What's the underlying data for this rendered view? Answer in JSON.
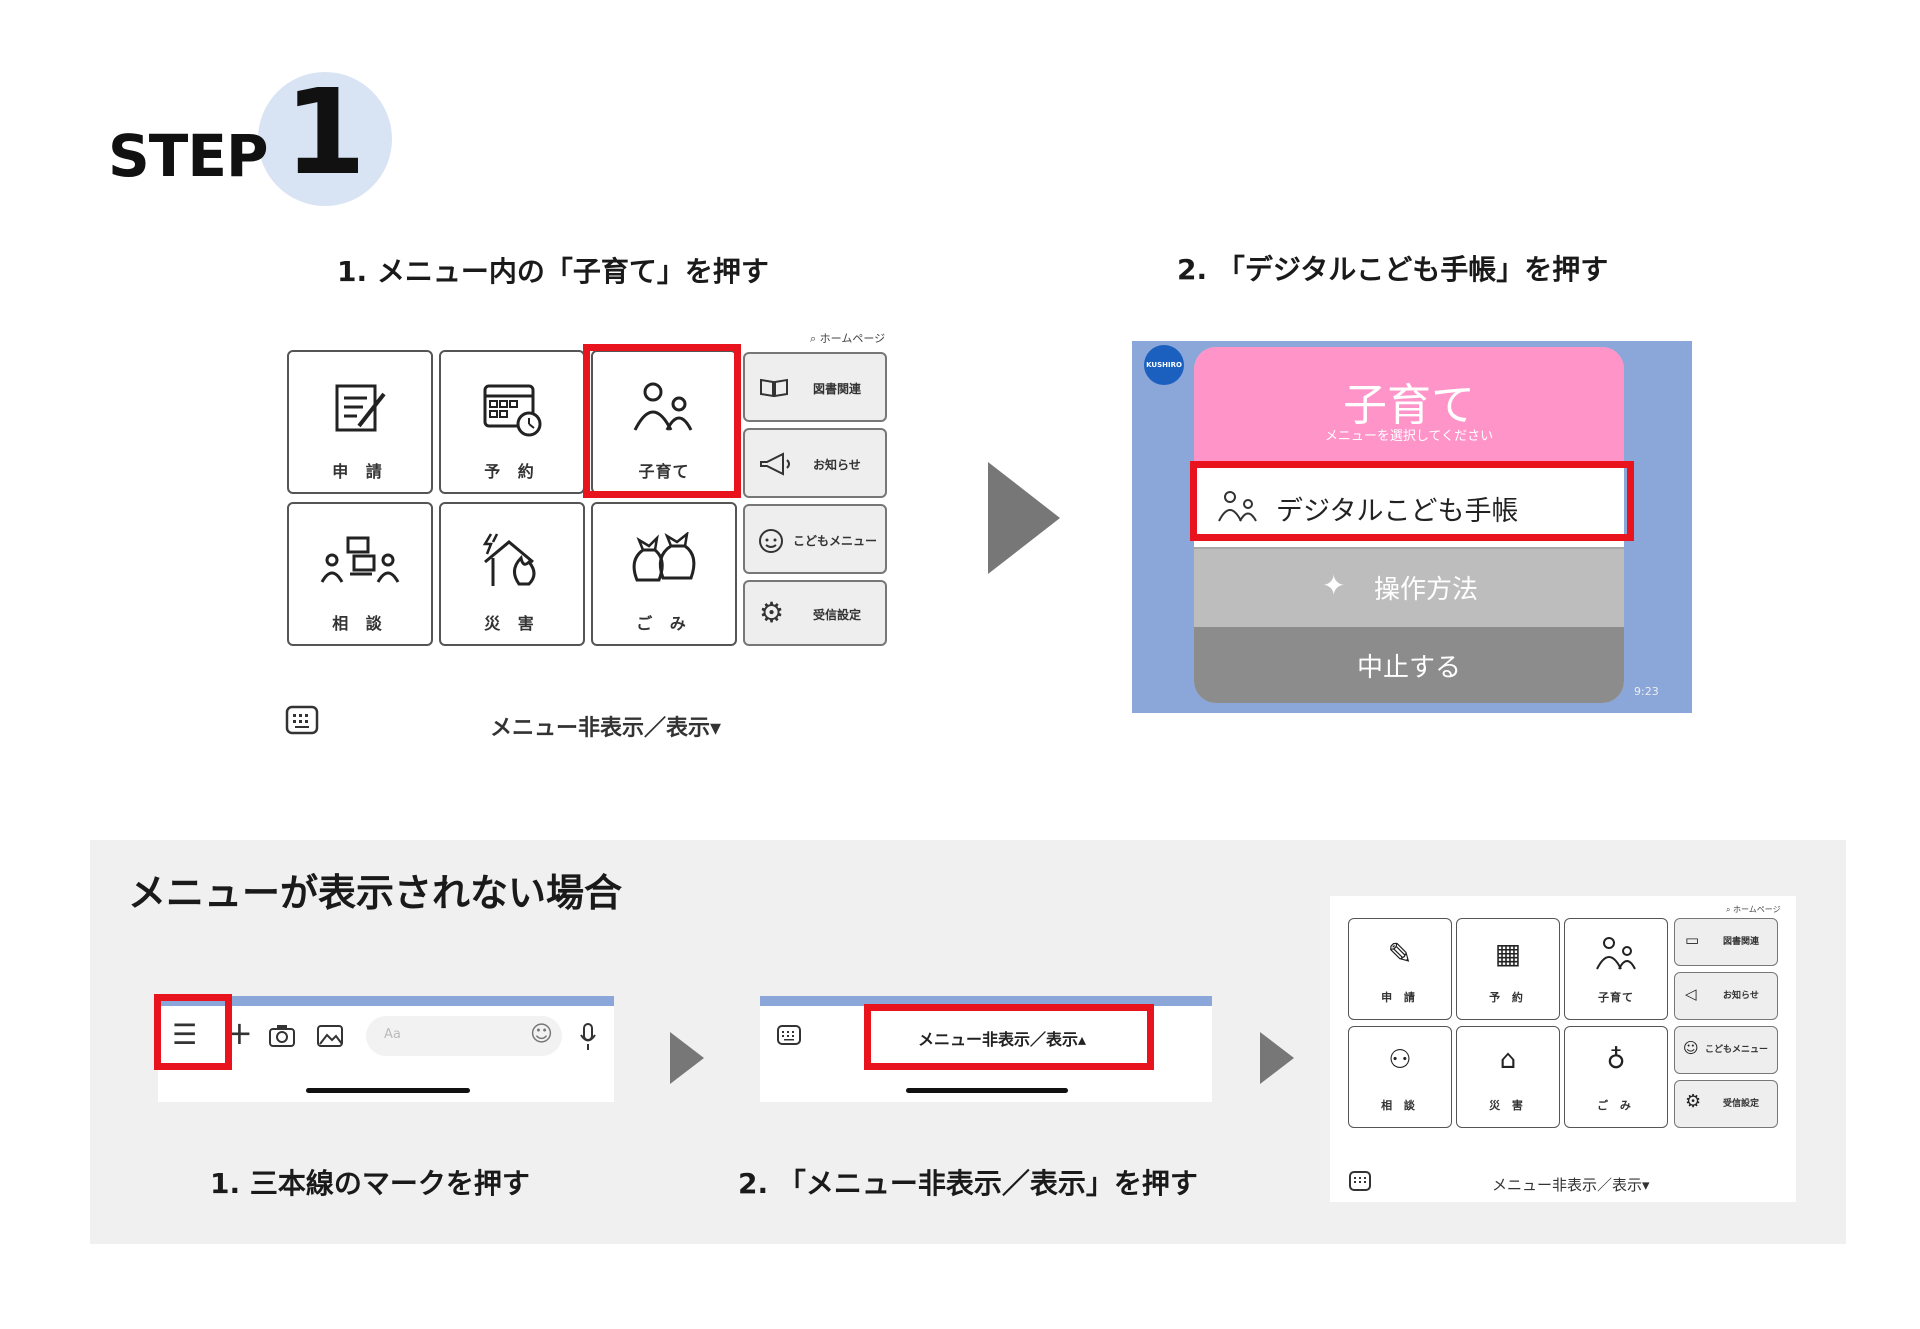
{
  "step": {
    "label": "STEP",
    "number": "1"
  },
  "instructions": {
    "step1": "1. メニュー内の「子育て」を押す",
    "step2": "2. 「デジタルこども手帳」を押す"
  },
  "menu": {
    "homepage_link": "ホームページ",
    "tiles": {
      "apply": "申 請",
      "reserve": "予 約",
      "childcare": "子育て",
      "consult": "相 談",
      "disaster": "災 害",
      "garbage": "ご み"
    },
    "side": {
      "library": "図書関連",
      "news": "お知らせ",
      "kids_menu": "こどもメニュー",
      "settings": "受信設定"
    },
    "toggle": "メニュー非表示／表示▾"
  },
  "popup": {
    "logo": "KUSHIRO",
    "title": "子育て",
    "subtitle": "メニューを選択してください",
    "option_digital": "デジタルこども手帳",
    "option_howto": "操作方法",
    "option_cancel": "中止する",
    "time": "9:23"
  },
  "fallback": {
    "heading": "メニューが表示されない場合",
    "input_placeholder": "Aa",
    "toggle_up": "メニュー非表示／表示▴",
    "caption1": "1. 三本線のマークを押す",
    "caption2": "2. 「メニュー非表示／表示」を押す"
  },
  "colors": {
    "highlight": "#e8131d",
    "pink": "#ff94c9",
    "step_circle": "#d8e3f3",
    "line_blue": "#8ba6d9"
  }
}
